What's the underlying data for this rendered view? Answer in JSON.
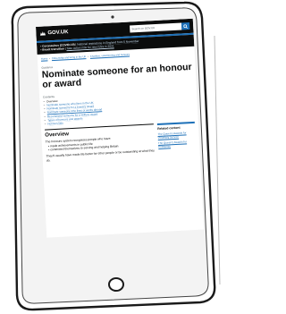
{
  "header": {
    "logo_text": "GOV.UK",
    "search_placeholder": "Search on GOV.UK"
  },
  "banner": {
    "items": [
      {
        "bold": "Coronavirus (COVID-19)",
        "text": "National restrictions in England from 5 November"
      },
      {
        "bold": "Brexit transition",
        "text": "Take action now for new rules in 2021"
      }
    ]
  },
  "breadcrumbs": [
    "Home",
    "Citizenship and living in the UK",
    "Charities, volunteering and honours"
  ],
  "page": {
    "caption": "Guidance",
    "title": "Nominate someone for an honour or award"
  },
  "contents": {
    "heading": "Contents",
    "items": [
      "Overview",
      "Nominate someone who lives in the UK",
      "Nominate someone for a bravery award",
      "Nominate someone who lives or works abroad",
      "Recommend someone for a military award",
      "Types of honours and awards",
      "Honours lists"
    ]
  },
  "overview": {
    "heading": "Overview",
    "intro": "The honours system recognises people who have:",
    "bullets": [
      "made achievements in public life",
      "committed themselves to serving and helping Britain"
    ],
    "more": "They'll usually have made life better for other people or be outstanding at what they do."
  },
  "related": {
    "heading": "Related content",
    "links": [
      "The Queen's Awards for Voluntary Service",
      "The Queen's Awards for Enterprise"
    ]
  },
  "colors": {
    "govuk_black": "#0b0c0c",
    "govuk_blue": "#1d70b8",
    "link_blue": "#1d70b8"
  }
}
